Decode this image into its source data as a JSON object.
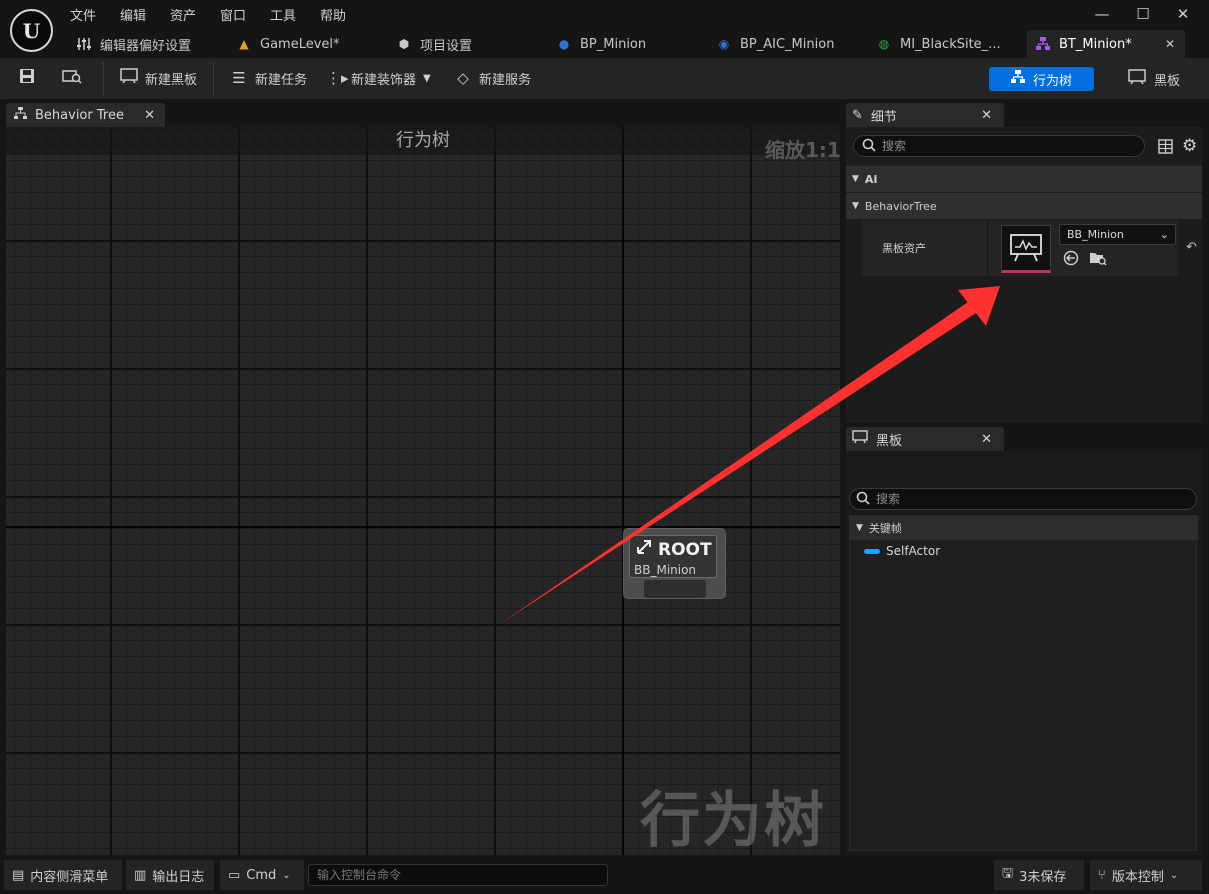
{
  "menu": [
    "文件",
    "编辑",
    "资产",
    "窗口",
    "工具",
    "帮助"
  ],
  "tabs": [
    {
      "label": "编辑器偏好设置",
      "icon": "sliders-icon"
    },
    {
      "label": "GameLevel*",
      "icon": "level-icon"
    },
    {
      "label": "项目设置",
      "icon": "cube-gear-icon"
    },
    {
      "label": "BP_Minion",
      "icon": "blueprint-pawn-icon"
    },
    {
      "label": "BP_AIC_Minion",
      "icon": "ai-controller-icon"
    },
    {
      "label": "MI_BlackSite_...",
      "icon": "material-instance-icon"
    },
    {
      "label": "BT_Minion*",
      "icon": "behavior-tree-icon",
      "active": true
    }
  ],
  "toolbar": {
    "new_blackboard": "新建黑板",
    "new_task": "新建任务",
    "new_decorator": "新建装饰器",
    "new_service": "新建服务",
    "mode_behavior_tree": "行为树",
    "mode_blackboard": "黑板"
  },
  "graph": {
    "tab_label": "Behavior Tree",
    "header": "行为树",
    "zoom": "缩放1:1",
    "watermark": "行为树",
    "root": {
      "title": "ROOT",
      "blackboard": "BB_Minion"
    }
  },
  "details": {
    "tab_label": "细节",
    "search_placeholder": "搜索",
    "categories": [
      "AI",
      "BehaviorTree"
    ],
    "property_label": "黑板资产",
    "asset_value": "BB_Minion"
  },
  "blackboard": {
    "tab_label": "黑板",
    "search_placeholder": "搜索",
    "category": "关键帧",
    "keys": [
      "SelfActor"
    ],
    "key_color": "#1aa3ff"
  },
  "status": {
    "content_drawer": "内容侧滑菜单",
    "output_log": "输出日志",
    "cmd": "Cmd",
    "console_placeholder": "输入控制台命令",
    "unsaved": "3未保存",
    "source_control": "版本控制"
  },
  "colors": {
    "accent": "#0070e0",
    "arrow": "#ff3030",
    "asset_underline": "#c0325a"
  }
}
